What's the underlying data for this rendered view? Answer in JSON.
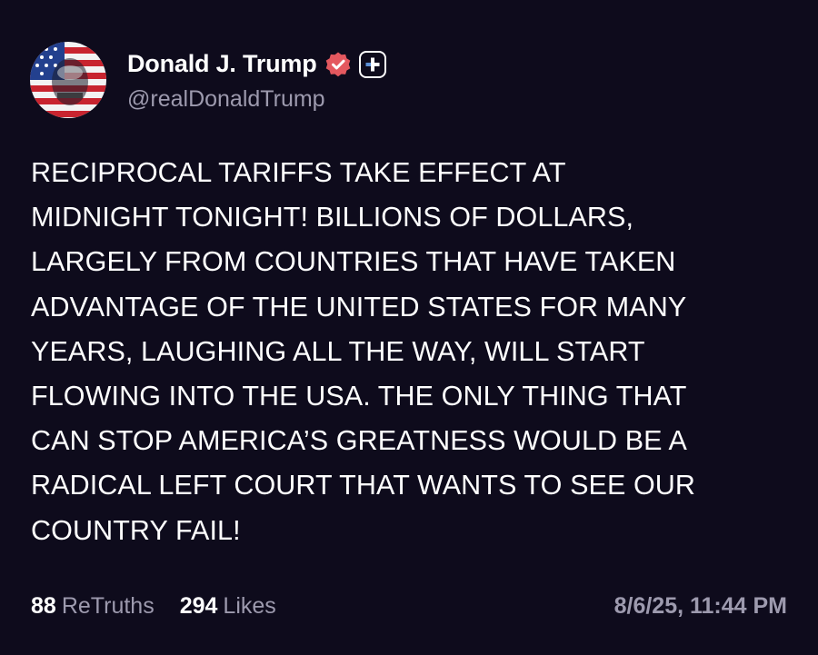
{
  "author": {
    "display_name": "Donald J. Trump",
    "handle": "@realDonaldTrump"
  },
  "icons": {
    "avatar": "avatar-flag-portrait",
    "verified": "verified-badge-icon",
    "subscription": "plus-badge-icon"
  },
  "colors": {
    "background": "#0e0b1c",
    "verified_badge": "#e4585f",
    "muted_text": "#9d9aae"
  },
  "post": {
    "lines": [
      "RECIPROCAL TARIFFS TAKE EFFECT AT",
      "MIDNIGHT TONIGHT! BILLIONS OF DOLLARS,",
      "LARGELY FROM COUNTRIES THAT HAVE TAKEN",
      "ADVANTAGE OF THE UNITED STATES FOR MANY",
      "YEARS, LAUGHING ALL THE WAY, WILL START",
      "FLOWING INTO THE USA. THE ONLY THING THAT",
      "CAN STOP AMERICA’S GREATNESS WOULD BE A",
      "RADICAL LEFT COURT THAT WANTS TO SEE OUR",
      "COUNTRY FAIL!"
    ]
  },
  "stats": {
    "retruths_count": "88",
    "retruths_label": "ReTruths",
    "likes_count": "294",
    "likes_label": "Likes"
  },
  "timestamp": "8/6/25, 11:44 PM"
}
